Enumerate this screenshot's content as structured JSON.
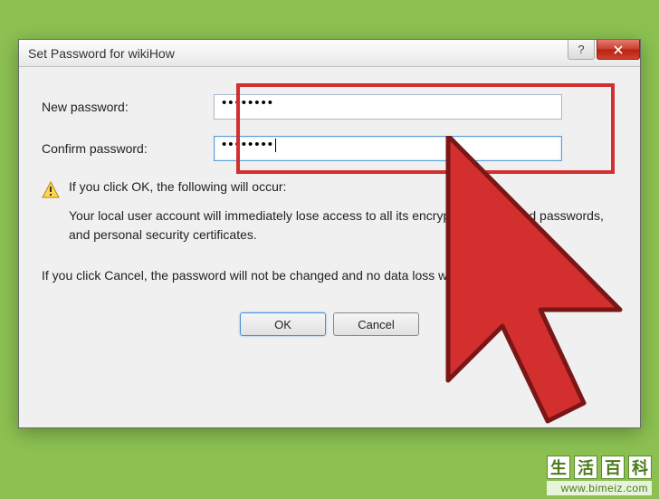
{
  "dialog": {
    "title": "Set Password for wikiHow",
    "newPasswordLabel": "New password:",
    "newPasswordValue": "••••••••",
    "confirmPasswordLabel": "Confirm password:",
    "confirmPasswordValue": "••••••••",
    "warningLine1": "If you click OK, the following will occur:",
    "warningLine2": "Your local user account will immediately lose access to all its encrypted files, stored passwords, and personal security certificates.",
    "warningLine3": "If you click Cancel, the password will not be changed and no data loss will occur.",
    "okLabel": "OK",
    "cancelLabel": "Cancel",
    "helpLabel": "?"
  },
  "watermark": {
    "url": "www.bimeiz.com",
    "brandChars": [
      "生",
      "活",
      "百",
      "科"
    ]
  }
}
